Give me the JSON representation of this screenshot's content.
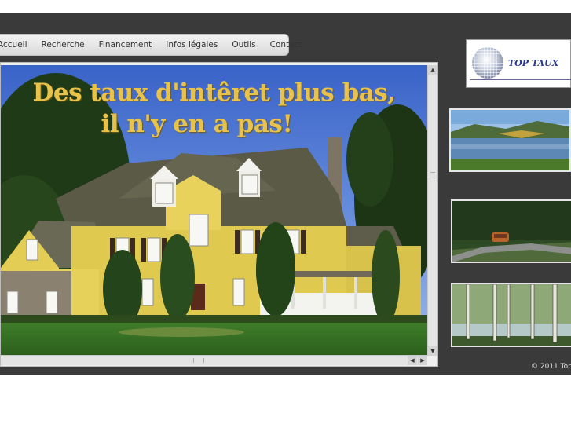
{
  "nav": {
    "items": [
      "Accueil",
      "Recherche",
      "Financement",
      "Infos légales",
      "Outils",
      "Contact"
    ]
  },
  "hero": {
    "headline_line1": "Des taux d'intêret plus bas,",
    "headline_line2": "il n'y en a pas!",
    "image": "house-photo"
  },
  "logo": {
    "brand": "TOP TAUX",
    "icon": "globe-icon"
  },
  "thumbnails": [
    {
      "image": "lake-landscape-photo"
    },
    {
      "image": "country-road-car-photo"
    },
    {
      "image": "birch-trees-river-photo"
    }
  ],
  "footer": {
    "copyright": "© 2011 Top"
  },
  "colors": {
    "background_band": "#3a3a3a",
    "headline": "#e8c24a",
    "brand": "#2a3a8f"
  }
}
